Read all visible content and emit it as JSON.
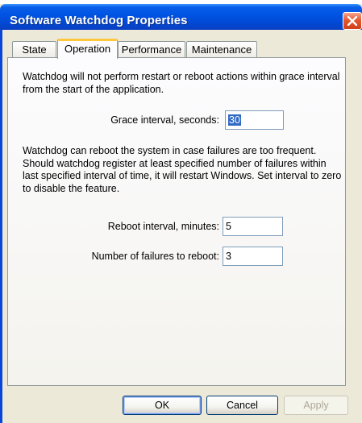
{
  "window": {
    "title": "Software Watchdog Properties"
  },
  "tabs": [
    {
      "label": "State"
    },
    {
      "label": "Operation"
    },
    {
      "label": "Performance"
    },
    {
      "label": "Maintenance"
    }
  ],
  "operation": {
    "grace_description": "Watchdog will not perform restart or reboot actions within grace interval from the start of the application.",
    "grace_label": "Grace interval, seconds:",
    "grace_value": "30",
    "reboot_description": "Watchdog can reboot the system in case failures are too frequent. Should watchdog register at least specified number of failures within last specified interval of time, it will restart Windows. Set interval to zero to disable the feature.",
    "reboot_interval_label": "Reboot interval, minutes:",
    "reboot_interval_value": "5",
    "failures_label": "Number of failures to reboot:",
    "failures_value": "3"
  },
  "buttons": {
    "ok": "OK",
    "cancel": "Cancel",
    "apply": "Apply"
  },
  "colors": {
    "titlebar": "#0054e3",
    "active_tab_highlight": "#ffc83c",
    "selection": "#316ac5",
    "close_button": "#e3582f"
  },
  "icons": {
    "close": "close-icon"
  }
}
